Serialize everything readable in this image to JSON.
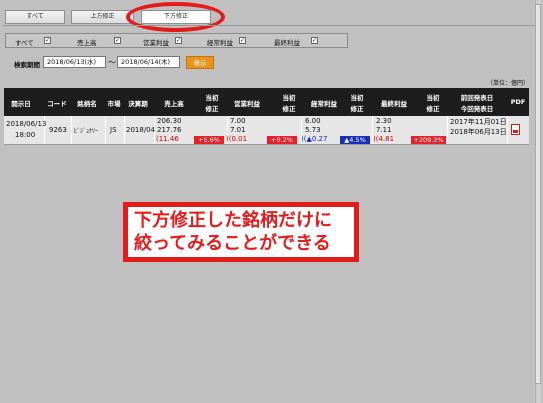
{
  "tabs": [
    {
      "label": "すべて",
      "active": false
    },
    {
      "label": "上方修正",
      "active": false
    },
    {
      "label": "下方修正",
      "active": true
    }
  ],
  "filters": [
    {
      "label": "すべて",
      "checked": true
    },
    {
      "label": "売上高",
      "checked": true
    },
    {
      "label": "営業利益",
      "checked": true
    },
    {
      "label": "経常利益",
      "checked": true
    },
    {
      "label": "最終利益",
      "checked": true
    }
  ],
  "period": {
    "label": "検索期間",
    "from": "2018/06/13(水)",
    "separator": "〜",
    "to": "2018/06/14(木)",
    "button": "表示"
  },
  "unit": "（単位：億円）",
  "table": {
    "headers": {
      "date": "開示日",
      "code": "コード",
      "name": "銘柄名",
      "market": "市場",
      "period": "決算期",
      "sales": "売上高",
      "initial": "当初",
      "revision": "修正",
      "op_profit": "営業利益",
      "ord_profit": "経常利益",
      "net_profit": "最終利益",
      "prev_date": "前回発表日",
      "curr_date": "今回発表日",
      "pdf": "PDF"
    },
    "row": {
      "date_line1": "2018/06/13",
      "date_line2": "18:00",
      "code": "9263",
      "name": "ﾋﾞｼﾞｮﾅﾘｰ",
      "market": "JS",
      "period": "2018/04",
      "sales_old": "206.30",
      "sales_new": "217.76",
      "sales_diff": "(11.46",
      "sales_pct": "+5.6%",
      "op_old": "7.00",
      "op_new": "7.01",
      "op_diff": ")(0.01",
      "op_pct": "+0.2%",
      "ord_old": "6.00",
      "ord_new": "5.73",
      "ord_diff": ")(▲0.27",
      "ord_pct": "▲4.5%",
      "net_old": "2.30",
      "net_new": "7.11",
      "net_diff": ")(4.81",
      "net_pct": "+209.2%",
      "prev_date": "2017年11月01日",
      "curr_date": "2018年06月13日"
    }
  },
  "annotation": {
    "line1": "下方修正した銘柄だけに",
    "line2": "絞ってみることができる"
  },
  "colors": {
    "accent_red": "#e41b1b",
    "button_orange": "#e8951f",
    "header_black": "#1d1d1d",
    "negative_blue": "#1a2fb8"
  }
}
